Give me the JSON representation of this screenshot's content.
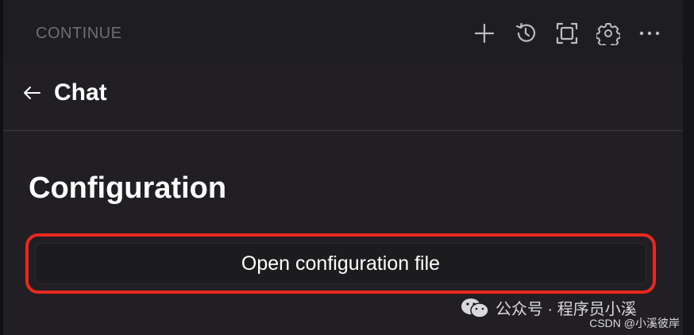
{
  "header": {
    "title": "CONTINUE",
    "icons": [
      "plus-icon",
      "history-icon",
      "fullscreen-icon",
      "gear-icon",
      "more-icon"
    ]
  },
  "chat_bar": {
    "title": "Chat"
  },
  "main": {
    "heading": "Configuration",
    "open_config_label": "Open configuration file"
  },
  "watermark": {
    "line1": "公众号 · 程序员小溪",
    "line2": "CSDN @小溪彼岸"
  },
  "colors": {
    "accent_highlight": "#e8281f",
    "background": "#1b1a1d",
    "panel": "#211f23",
    "text": "#ffffff",
    "muted_text": "#6f6e73"
  }
}
